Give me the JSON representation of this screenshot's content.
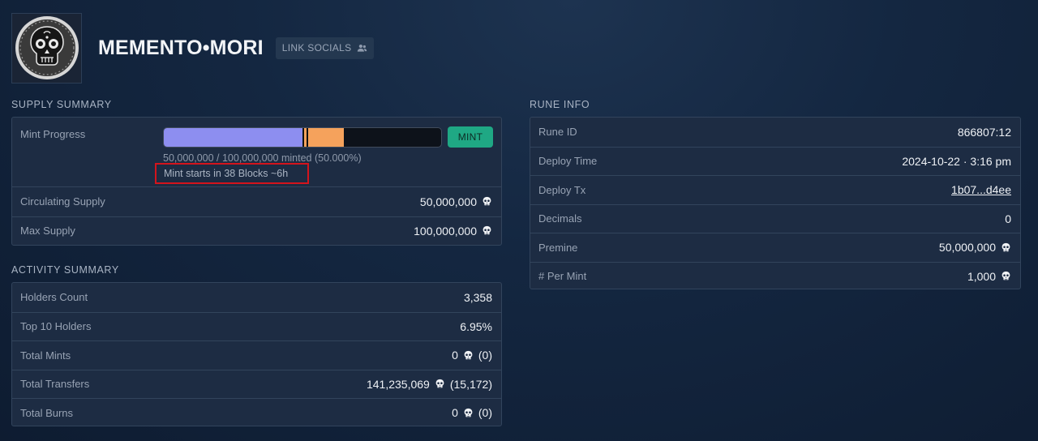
{
  "header": {
    "title": "MEMENTO•MORI",
    "link_socials_label": "LINK SOCIALS"
  },
  "supply_summary": {
    "heading": "SUPPLY SUMMARY",
    "mint_progress_label": "Mint Progress",
    "mint_button_label": "MINT",
    "progress_minted_fraction": 0.5,
    "progress_pending_fraction": 0.15,
    "minted_text": "50,000,000 / 100,000,000 minted (50.000%)",
    "mint_starts_text": "Mint starts in 38 Blocks ~6h",
    "rows": [
      {
        "label": "Circulating Supply",
        "value": "50,000,000"
      },
      {
        "label": "Max Supply",
        "value": "100,000,000"
      }
    ]
  },
  "activity_summary": {
    "heading": "ACTIVITY SUMMARY",
    "rows": [
      {
        "label": "Holders Count",
        "value": "3,358"
      },
      {
        "label": "Top 10 Holders",
        "value": "6.95%"
      },
      {
        "label": "Total Mints",
        "value": "0",
        "paren": "(0)"
      },
      {
        "label": "Total Transfers",
        "value": "141,235,069",
        "paren": "(15,172)"
      },
      {
        "label": "Total Burns",
        "value": "0",
        "paren": "(0)"
      }
    ]
  },
  "rune_info": {
    "heading": "RUNE INFO",
    "rows": [
      {
        "label": "Rune ID",
        "value": "866807:12"
      },
      {
        "label": "Deploy Time",
        "value": "2024-10-22 · 3:16 pm"
      },
      {
        "label": "Deploy Tx",
        "value": "1b07...d4ee"
      },
      {
        "label": "Decimals",
        "value": "0"
      },
      {
        "label": "Premine",
        "value": "50,000,000"
      },
      {
        "label": "# Per Mint",
        "value": "1,000"
      }
    ]
  },
  "colors": {
    "minted_fill": "#8d8ef0",
    "pending_fill": "#f5a25c",
    "mint_button": "#1fa884",
    "highlight_box": "#d4141c"
  },
  "icons": {
    "rune_symbol": "skull-icon",
    "link_socials": "users-icon",
    "logo": "sugar-skull-logo"
  }
}
